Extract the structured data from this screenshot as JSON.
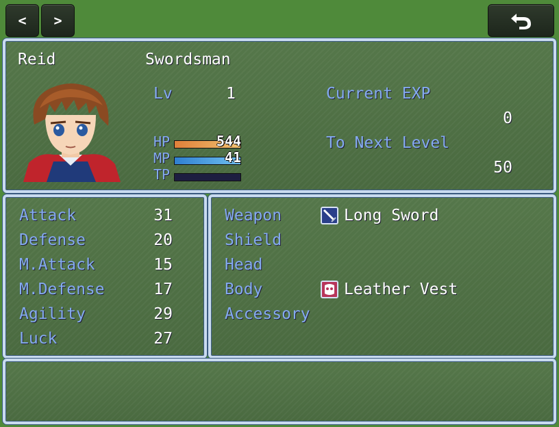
{
  "nav": {
    "prev_label": "<",
    "next_label": ">",
    "back_icon": "return-arrow-icon"
  },
  "actor": {
    "name": "Reid",
    "class": "Swordsman",
    "level_label": "Lv",
    "level": "1",
    "hp_label": "HP",
    "hp": "544",
    "hp_fill": 1.0,
    "mp_label": "MP",
    "mp": "41",
    "mp_fill": 1.0,
    "tp_label": "TP",
    "tp_fill": 0.0,
    "current_exp_label": "Current EXP",
    "current_exp": "0",
    "next_level_label": "To Next Level",
    "next_level": "50"
  },
  "params": [
    {
      "label": "Attack",
      "value": "31"
    },
    {
      "label": "Defense",
      "value": "20"
    },
    {
      "label": "M.Attack",
      "value": "15"
    },
    {
      "label": "M.Defense",
      "value": "17"
    },
    {
      "label": "Agility",
      "value": "29"
    },
    {
      "label": "Luck",
      "value": "27"
    }
  ],
  "equips": [
    {
      "slot": "Weapon",
      "item": "Long Sword",
      "icon": "sword-icon"
    },
    {
      "slot": "Shield",
      "item": "",
      "icon": ""
    },
    {
      "slot": "Head",
      "item": "",
      "icon": ""
    },
    {
      "slot": "Body",
      "item": "Leather Vest",
      "icon": "armor-icon"
    },
    {
      "slot": "Accessory",
      "item": "",
      "icon": ""
    }
  ],
  "colors": {
    "system_text": "#84aaf0",
    "hp_gauge": [
      "#e0803a",
      "#f0c070"
    ],
    "mp_gauge": [
      "#2f7fd0",
      "#70c0f0"
    ]
  }
}
